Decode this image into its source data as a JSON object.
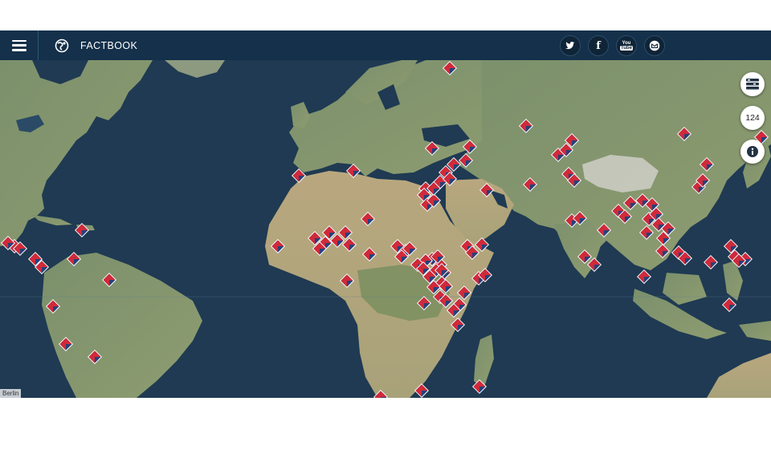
{
  "header": {
    "menu_icon": "hamburger-icon",
    "logo_icon": "globe-logo-icon",
    "title": "FACTBOOK"
  },
  "social": [
    {
      "name": "twitter",
      "icon": "twitter-icon",
      "glyph": "🐦"
    },
    {
      "name": "facebook",
      "icon": "facebook-icon",
      "glyph": "f"
    },
    {
      "name": "youtube",
      "icon": "youtube-icon",
      "glyph": "You Tube"
    },
    {
      "name": "email",
      "icon": "email-icon",
      "glyph": "✉"
    }
  ],
  "controls": {
    "layers_icon": "layers-icon",
    "count": "124",
    "info_icon": "info-icon"
  },
  "map": {
    "attribution": "Berlin",
    "colors": {
      "ocean": "#1f3a52",
      "land": "#7a8f6a",
      "marker_red": "#d02a3a",
      "marker_blue": "#2a3f78"
    }
  }
}
